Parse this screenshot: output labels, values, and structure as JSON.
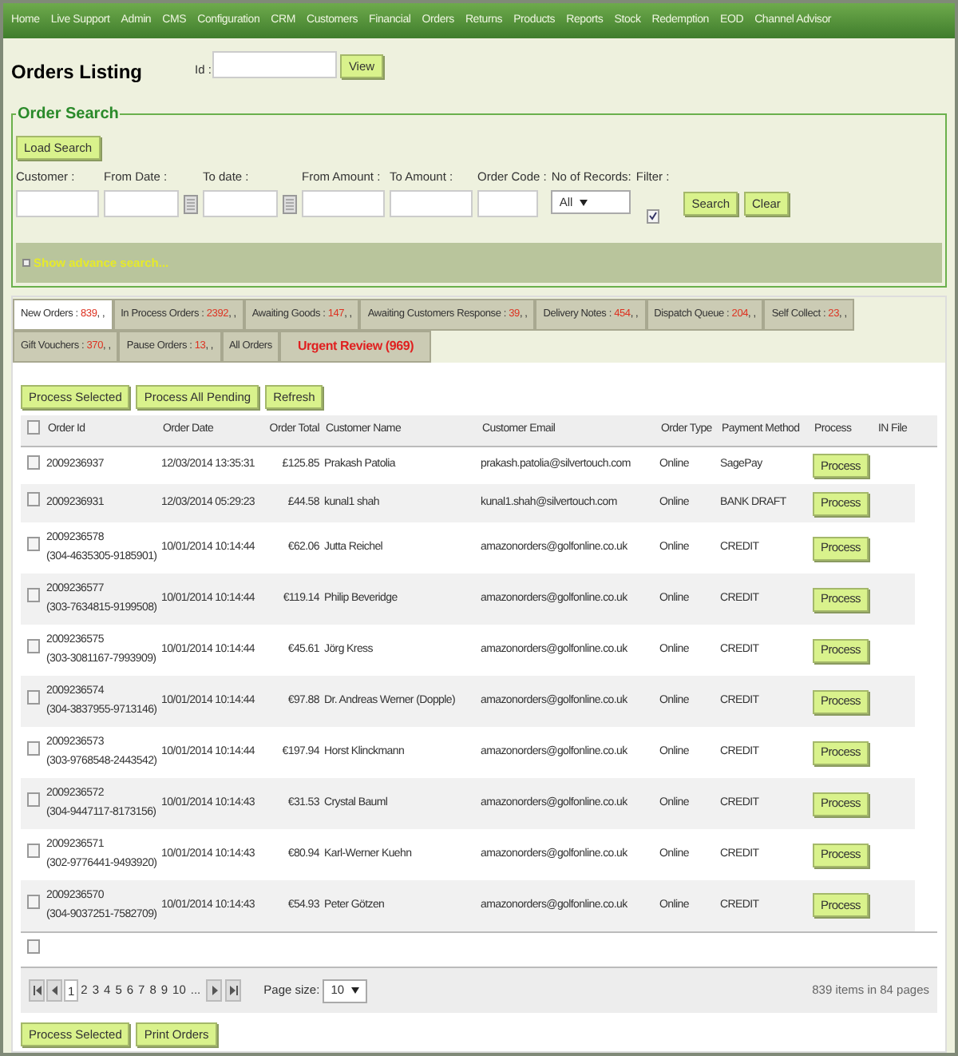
{
  "nav": [
    "Home",
    "Live Support",
    "Admin",
    "CMS",
    "Configuration",
    "CRM",
    "Customers",
    "Financial",
    "Orders",
    "Returns",
    "Products",
    "Reports",
    "Stock",
    "Redemption",
    "EOD",
    "Channel Advisor"
  ],
  "page_title": "Orders Listing",
  "id_field": {
    "label": "Id :",
    "button": "View"
  },
  "search": {
    "legend": "Order Search",
    "load_button": "Load Search",
    "fields": [
      {
        "kind": "text",
        "label": "Customer :"
      },
      {
        "kind": "date",
        "label": "From Date :"
      },
      {
        "kind": "date",
        "label": "To date :"
      },
      {
        "kind": "text",
        "label": "From Amount :"
      },
      {
        "kind": "text",
        "label": "To Amount :"
      },
      {
        "kind": "code",
        "label": "Order Code :"
      },
      {
        "kind": "select",
        "label": "No of Records:",
        "value": "All"
      },
      {
        "kind": "check",
        "label": "Filter :",
        "checked": true
      }
    ],
    "buttons": [
      "Search",
      "Clear"
    ],
    "advanced": "Show advance search..."
  },
  "tabs": [
    [
      {
        "kind": "count",
        "label": "New Orders :",
        "count": "839",
        "suffix": ", ,",
        "selected": true
      },
      {
        "kind": "count",
        "label": "In Process Orders :",
        "count": "2392",
        "suffix": ", ,",
        "selected": false
      },
      {
        "kind": "count",
        "label": "Awaiting Goods :",
        "count": "147",
        "suffix": ", ,",
        "selected": false
      },
      {
        "kind": "count",
        "label": "Awaiting Customers Response :",
        "count": "39",
        "suffix": ", ,",
        "selected": false
      },
      {
        "kind": "count",
        "label": "Delivery Notes :",
        "count": "454",
        "suffix": ", ,",
        "selected": false
      },
      {
        "kind": "count",
        "label": "Dispatch Queue :",
        "count": "204",
        "suffix": ", ,",
        "selected": false
      },
      {
        "kind": "count",
        "label": "Self Collect :",
        "count": "23",
        "suffix": ", ,",
        "selected": false
      }
    ],
    [
      {
        "kind": "count",
        "label": "Gift Vouchers :",
        "count": "370",
        "suffix": ", ,",
        "selected": false
      },
      {
        "kind": "count",
        "label": "Pause Orders :",
        "count": "13",
        "suffix": ", ,",
        "selected": false
      },
      {
        "kind": "plain",
        "label": "All Orders",
        "selected": false
      },
      {
        "kind": "urgent",
        "label": "Urgent Review (969)",
        "selected": false
      }
    ]
  ],
  "actions": [
    "Process Selected",
    "Process All Pending",
    "Refresh"
  ],
  "table": {
    "header_checked": false,
    "columns": [
      "Order Id",
      "Order Date",
      "Order Total",
      "Customer Name",
      "Customer Email",
      "Order Type",
      "Payment Method",
      "Process",
      "IN File"
    ],
    "rows": [
      {
        "checked": false,
        "id": "2009236937",
        "date": "12/03/2014 13:35:31",
        "total": "£125.85",
        "name": "Prakash Patolia",
        "email": "prakash.patolia@silvertouch.com",
        "type": "Online",
        "payment": "SagePay",
        "process": "Process"
      },
      {
        "checked": false,
        "id": "2009236931",
        "date": "12/03/2014 05:29:23",
        "total": "£44.58",
        "name": "kunal1 shah",
        "email": "kunal1.shah@silvertouch.com",
        "type": "Online",
        "payment": "BANK DRAFT",
        "process": "Process"
      },
      {
        "checked": false,
        "id": "2009236578",
        "ref": "(304-4635305-9185901)",
        "date": "10/01/2014 10:14:44",
        "total": "€62.06",
        "name": "Jutta Reichel",
        "email": "amazonorders@golfonline.co.uk",
        "type": "Online",
        "payment": "CREDIT",
        "process": "Process"
      },
      {
        "checked": false,
        "id": "2009236577",
        "ref": "(303-7634815-9199508)",
        "date": "10/01/2014 10:14:44",
        "total": "€119.14",
        "name": "Philip Beveridge",
        "email": "amazonorders@golfonline.co.uk",
        "type": "Online",
        "payment": "CREDIT",
        "process": "Process"
      },
      {
        "checked": false,
        "id": "2009236575",
        "ref": "(303-3081167-7993909)",
        "date": "10/01/2014 10:14:44",
        "total": "€45.61",
        "name": "Jörg Kress",
        "email": "amazonorders@golfonline.co.uk",
        "type": "Online",
        "payment": "CREDIT",
        "process": "Process"
      },
      {
        "checked": false,
        "id": "2009236574",
        "ref": "(304-3837955-9713146)",
        "date": "10/01/2014 10:14:44",
        "total": "€97.88",
        "name": "Dr. Andreas Werner (Dopple)",
        "email": "amazonorders@golfonline.co.uk",
        "type": "Online",
        "payment": "CREDIT",
        "process": "Process"
      },
      {
        "checked": false,
        "id": "2009236573",
        "ref": "(303-9768548-2443542)",
        "date": "10/01/2014 10:14:44",
        "total": "€197.94",
        "name": "Horst Klinckmann",
        "email": "amazonorders@golfonline.co.uk",
        "type": "Online",
        "payment": "CREDIT",
        "process": "Process"
      },
      {
        "checked": false,
        "id": "2009236572",
        "ref": "(304-9447117-8173156)",
        "date": "10/01/2014 10:14:43",
        "total": "€31.53",
        "name": "Crystal Bauml",
        "email": "amazonorders@golfonline.co.uk",
        "type": "Online",
        "payment": "CREDIT",
        "process": "Process"
      },
      {
        "checked": false,
        "id": "2009236571",
        "ref": "(302-9776441-9493920)",
        "date": "10/01/2014 10:14:43",
        "total": "€80.94",
        "name": "Karl-Werner Kuehn",
        "email": "amazonorders@golfonline.co.uk",
        "type": "Online",
        "payment": "CREDIT",
        "process": "Process"
      },
      {
        "checked": false,
        "id": "2009236570",
        "ref": "(304-9037251-7582709)",
        "date": "10/01/2014 10:14:43",
        "total": "€54.93",
        "name": "Peter Götzen",
        "email": "amazonorders@golfonline.co.uk",
        "type": "Online",
        "payment": "CREDIT",
        "process": "Process"
      }
    ],
    "footer_checked": false
  },
  "pager": {
    "pages": [
      {
        "label": "1",
        "selected": true
      },
      {
        "label": "2",
        "selected": false
      },
      {
        "label": "3",
        "selected": false
      },
      {
        "label": "4",
        "selected": false
      },
      {
        "label": "5",
        "selected": false
      },
      {
        "label": "6",
        "selected": false
      },
      {
        "label": "7",
        "selected": false
      },
      {
        "label": "8",
        "selected": false
      },
      {
        "label": "9",
        "selected": false
      },
      {
        "label": "10",
        "selected": false
      },
      {
        "label": "...",
        "selected": false
      }
    ],
    "page_size_label": "Page size:",
    "page_size": "10",
    "summary": "839 items in 84 pages"
  },
  "bottom_buttons": [
    "Process Selected",
    "Print Orders"
  ]
}
